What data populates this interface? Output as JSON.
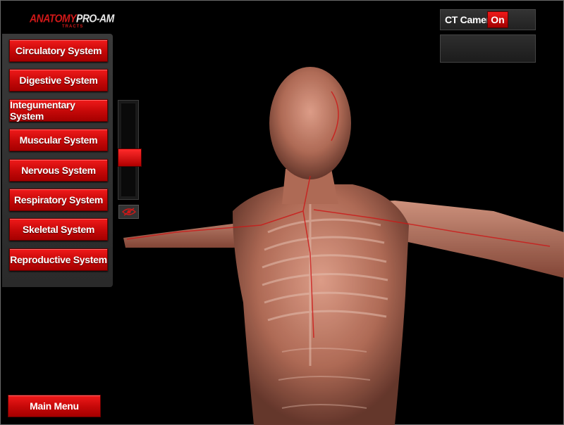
{
  "app": {
    "logo_brand": "ANATOMY",
    "logo_product": "PRO-AM",
    "logo_sub": "TRACTS"
  },
  "systems": [
    {
      "label": "Circulatory System"
    },
    {
      "label": "Digestive System"
    },
    {
      "label": "Integumentary System"
    },
    {
      "label": "Muscular System"
    },
    {
      "label": "Nervous System"
    },
    {
      "label": "Respiratory System"
    },
    {
      "label": "Skeletal System"
    },
    {
      "label": "Reproductive System"
    }
  ],
  "transparency_slider": {
    "level_fraction": 0.5
  },
  "ct_camera": {
    "label": "CT Camera",
    "state": "On"
  },
  "footer": {
    "main_menu_label": "Main Menu"
  },
  "colors": {
    "accent": "#d01818",
    "panel": "#2e2e2e",
    "background": "#000000"
  },
  "icons": {
    "visibility_toggle": "eye-icon"
  }
}
